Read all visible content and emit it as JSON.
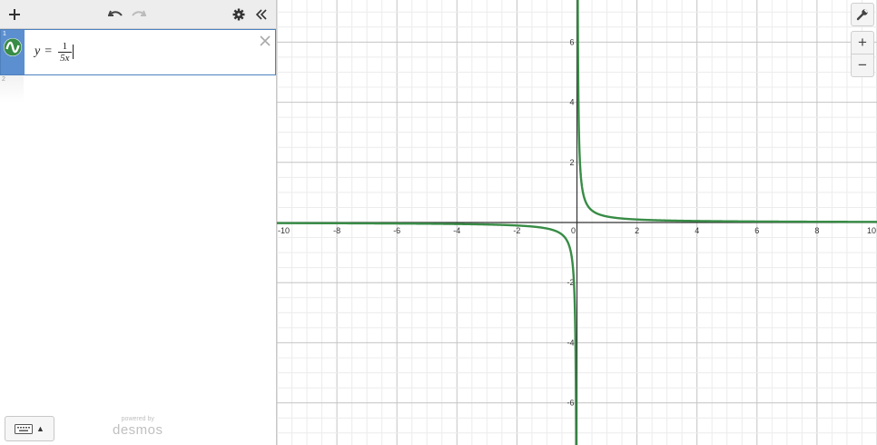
{
  "toolbar": {
    "add_icon": "plus-icon",
    "undo_icon": "undo-icon",
    "redo_icon": "redo-icon",
    "settings_icon": "gear-icon",
    "collapse_icon": "double-chevron-left-icon"
  },
  "expressions": [
    {
      "index": "1",
      "lhs": "y",
      "equals": "=",
      "numerator": "1",
      "denominator": "5x",
      "color": "#388c46",
      "active": true
    },
    {
      "index": "2"
    }
  ],
  "keyboard": {
    "icon": "keyboard-icon",
    "caret": "▲"
  },
  "branding": {
    "powered_by": "powered by",
    "logo": "desmos"
  },
  "graph_controls": {
    "settings_icon": "wrench-icon",
    "zoom_in": "+",
    "zoom_out": "−"
  },
  "chart_data": {
    "type": "line",
    "xlim": [
      -10,
      10
    ],
    "ylim": [
      -7.4,
      7.4
    ],
    "x_ticks": [
      -10,
      -8,
      -6,
      -4,
      -2,
      0,
      2,
      4,
      6,
      8,
      10
    ],
    "y_ticks": [
      -6,
      -4,
      -2,
      2,
      4,
      6
    ],
    "x_tick_labels": [
      "-10",
      "-8",
      "-6",
      "-4",
      "-2",
      "0",
      "2",
      "4",
      "6",
      "8",
      "10"
    ],
    "y_tick_labels": [
      "-6",
      "-4",
      "-2",
      "2",
      "4",
      "6"
    ],
    "grid": true,
    "minor_grid_step": 0.5,
    "series": [
      {
        "expression": "y = 1/(5x)",
        "color": "#388c46"
      }
    ]
  }
}
